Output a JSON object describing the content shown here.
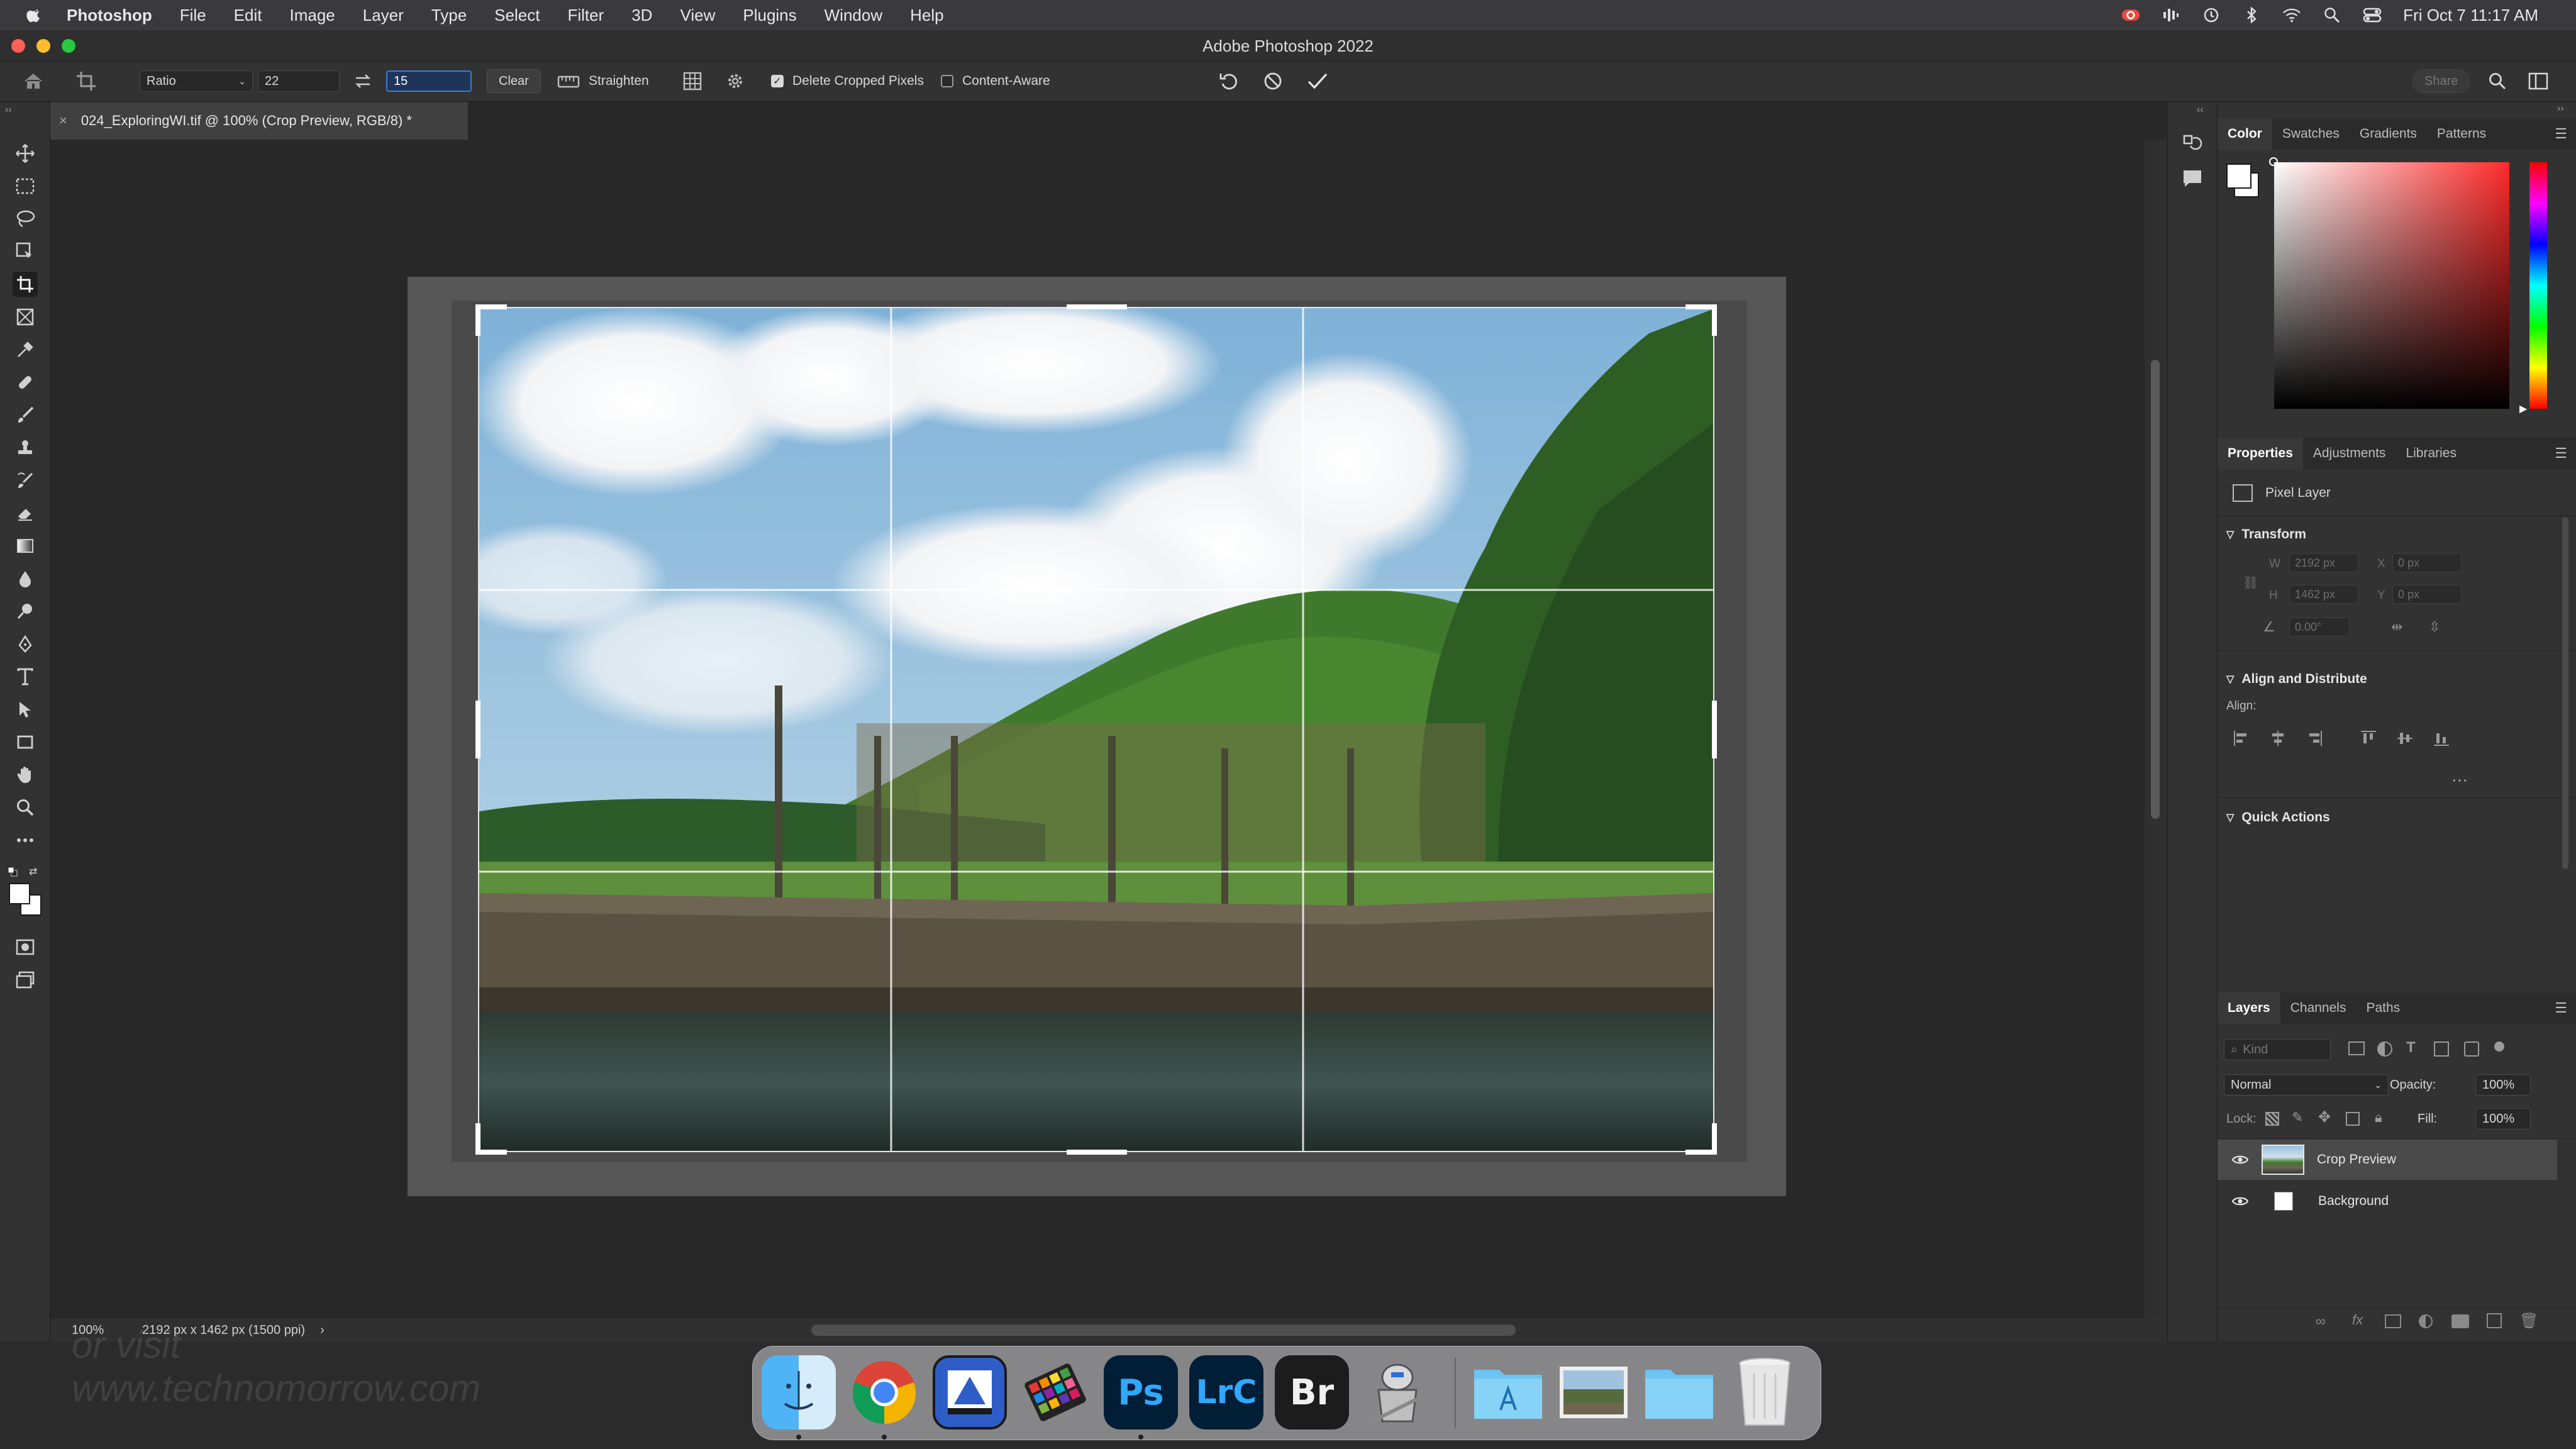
{
  "menubar": {
    "app_name": "Photoshop",
    "items": [
      "File",
      "Edit",
      "Image",
      "Layer",
      "Type",
      "Select",
      "Filter",
      "3D",
      "View",
      "Plugins",
      "Window",
      "Help"
    ],
    "clock": "Fri Oct 7  11:17 AM"
  },
  "window": {
    "title": "Adobe Photoshop 2022"
  },
  "options_bar": {
    "ratio_select": "Ratio",
    "width_value": "22",
    "height_value": "15",
    "clear_label": "Clear",
    "straighten_label": "Straighten",
    "delete_cropped_label": "Delete Cropped Pixels",
    "delete_cropped_checked": true,
    "content_aware_label": "Content-Aware",
    "content_aware_checked": false,
    "share_label": "Share"
  },
  "document": {
    "tab_title": "024_ExploringWI.tif @ 100% (Crop Preview, RGB/8) *",
    "zoom": "100%",
    "info": "2192 px x 1462 px (1500 ppi)"
  },
  "color_panel": {
    "tabs": [
      "Color",
      "Swatches",
      "Gradients",
      "Patterns"
    ],
    "active_tab": "Color",
    "hue_color": "#ff2a2a"
  },
  "properties_panel": {
    "tabs": [
      "Properties",
      "Adjustments",
      "Libraries"
    ],
    "active_tab": "Properties",
    "layer_type": "Pixel Layer",
    "transform_title": "Transform",
    "w_label": "W",
    "w_value": "2192 px",
    "x_label": "X",
    "x_value": "0 px",
    "h_label": "H",
    "h_value": "1462 px",
    "y_label": "Y",
    "y_value": "0 px",
    "angle_value": "0.00°",
    "align_title": "Align and Distribute",
    "align_label": "Align:",
    "quick_actions_title": "Quick Actions"
  },
  "layers_panel": {
    "tabs": [
      "Layers",
      "Channels",
      "Paths"
    ],
    "active_tab": "Layers",
    "filter_placeholder": "Kind",
    "blend_mode": "Normal",
    "opacity_label": "Opacity:",
    "opacity_value": "100%",
    "lock_label": "Lock:",
    "fill_label": "Fill:",
    "fill_value": "100%",
    "layers": [
      {
        "name": "Crop Preview",
        "visible": true,
        "selected": true
      },
      {
        "name": "Background",
        "visible": true,
        "selected": false
      }
    ]
  },
  "dock": {
    "apps": [
      "Finder",
      "Chrome",
      "Preview",
      "Color Picker",
      "Ps",
      "LrC",
      "Br",
      "Automator",
      "Applications",
      "Photo",
      "Folder",
      "Trash"
    ]
  },
  "watermark_text": "or visit www.technomorrow.com"
}
